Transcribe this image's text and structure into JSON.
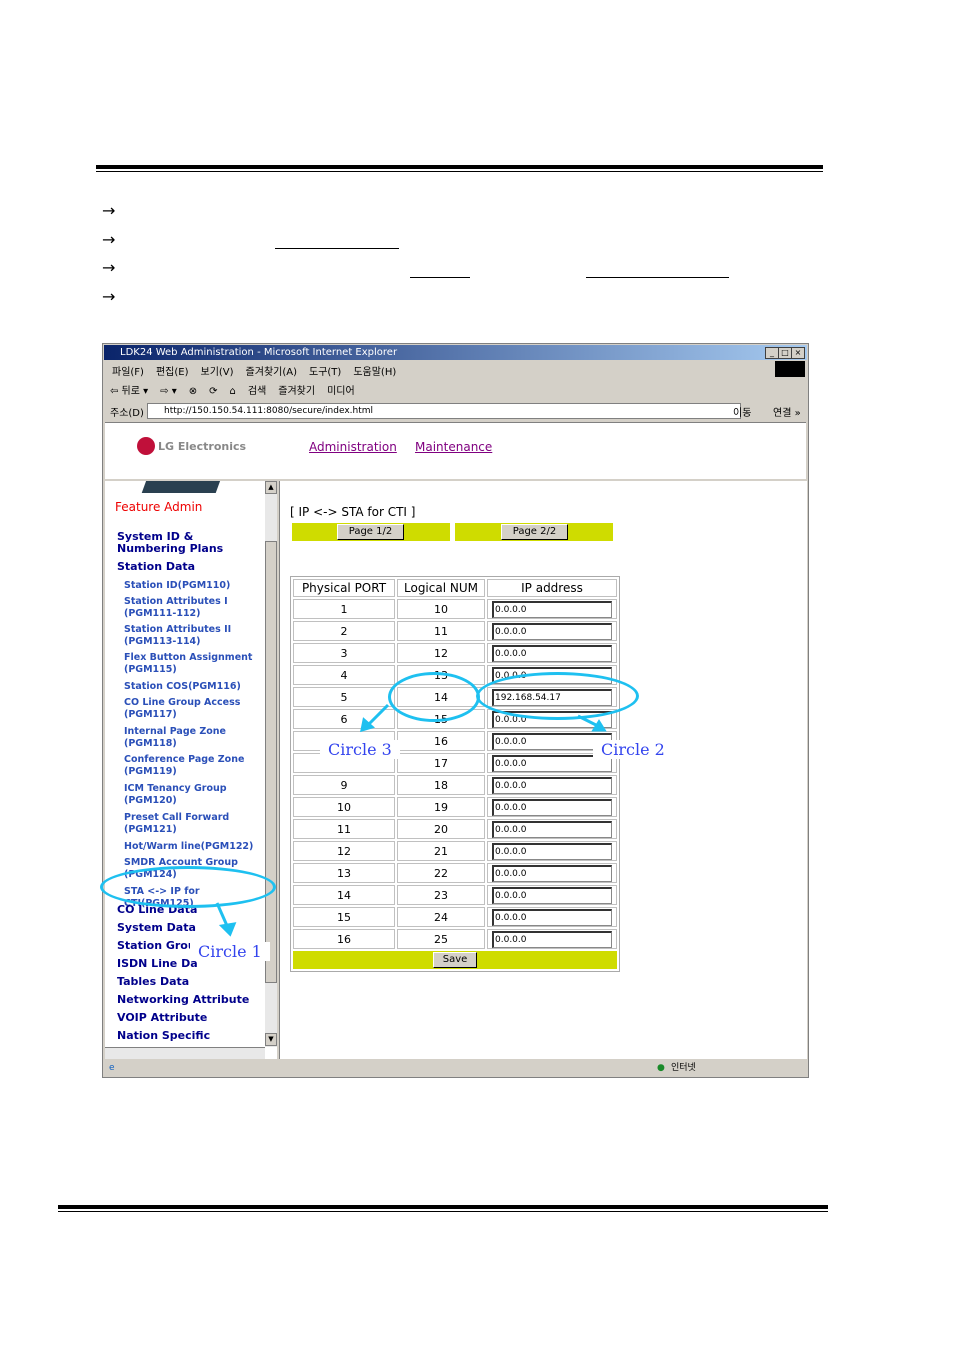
{
  "browser": {
    "title": "LDK24 Web Administration - Microsoft Internet Explorer",
    "menu": [
      "파일(F)",
      "편집(E)",
      "보기(V)",
      "즐겨찾기(A)",
      "도구(T)",
      "도움말(H)"
    ],
    "toolbar": [
      "⇦ 뒤로 ▾",
      "⇨ ▾",
      "⊗",
      "⟳",
      "⌂",
      "검색",
      "즐겨찾기",
      "미디어"
    ],
    "address_label": "주소(D)",
    "url": "http://150.150.54.111:8080/secure/index.html",
    "go": "이동",
    "links": "연결 »",
    "status_zone": "인터넷"
  },
  "header": {
    "logo": "LG Electronics",
    "nav": [
      "Administration",
      "Maintenance"
    ]
  },
  "sidebar": {
    "heading": "Feature Admin",
    "top": [
      "System ID & Numbering Plans",
      "Station Data"
    ],
    "sub": [
      "Station ID(PGM110)",
      "Station Attributes I (PGM111-112)",
      "Station Attributes II (PGM113-114)",
      "Flex Button Assignment (PGM115)",
      "Station COS(PGM116)",
      "CO Line Group Access (PGM117)",
      "Internal Page Zone (PGM118)",
      "Conference Page Zone (PGM119)",
      "ICM Tenancy Group (PGM120)",
      "Preset Call Forward (PGM121)",
      "Hot/Warm line(PGM122)",
      "SMDR Account Group (PGM124)",
      "STA <-> IP for CTI(PGM125)"
    ],
    "bottom": [
      "CO Line Data",
      "System Data",
      "Station Grou",
      "ISDN Line Da",
      "Tables Data",
      "Networking Attribute",
      "VOIP Attribute",
      "Nation Specific"
    ]
  },
  "main": {
    "title": "[ IP <-> STA for CTI ]",
    "page1": "Page 1/2",
    "page2": "Page 2/2",
    "columns": [
      "Physical PORT",
      "Logical NUM",
      "IP address"
    ],
    "rows": [
      [
        "1",
        "10",
        "0.0.0.0"
      ],
      [
        "2",
        "11",
        "0.0.0.0"
      ],
      [
        "3",
        "12",
        "0.0.0.0"
      ],
      [
        "4",
        "13",
        "0.0.0.0"
      ],
      [
        "5",
        "14",
        "192.168.54.17"
      ],
      [
        "6",
        "15",
        "0.0.0.0"
      ],
      [
        "",
        "16",
        "0.0.0.0"
      ],
      [
        "",
        "17",
        "0.0.0.0"
      ],
      [
        "9",
        "18",
        "0.0.0.0"
      ],
      [
        "10",
        "19",
        "0.0.0.0"
      ],
      [
        "11",
        "20",
        "0.0.0.0"
      ],
      [
        "12",
        "21",
        "0.0.0.0"
      ],
      [
        "13",
        "22",
        "0.0.0.0"
      ],
      [
        "14",
        "23",
        "0.0.0.0"
      ],
      [
        "15",
        "24",
        "0.0.0.0"
      ],
      [
        "16",
        "25",
        "0.0.0.0"
      ]
    ],
    "save": "Save"
  },
  "annotations": [
    "Circle 1",
    "Circle 2",
    "Circle 3"
  ],
  "colors": {
    "accent_bar": "#cfdc00",
    "circle": "#1ec0f0",
    "label": "#3344ee"
  }
}
